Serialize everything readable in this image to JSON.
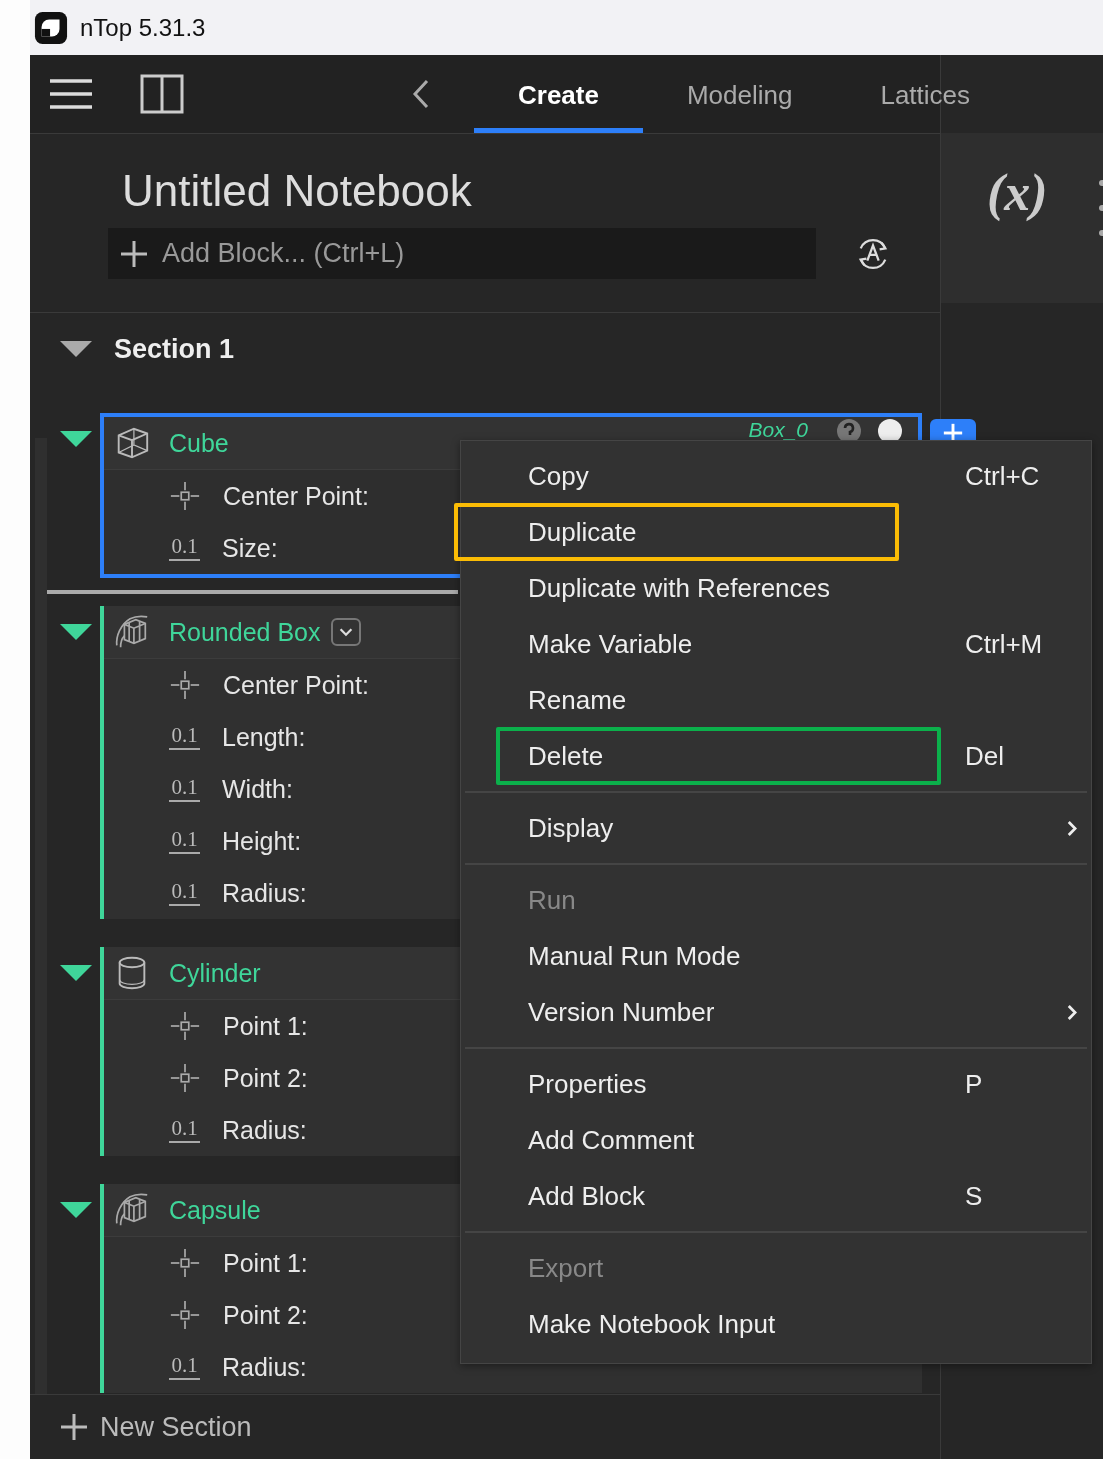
{
  "window": {
    "title": "nTop 5.31.3"
  },
  "tabs": [
    {
      "label": "Create",
      "selected": true
    },
    {
      "label": "Modeling",
      "selected": false
    },
    {
      "label": "Lattices",
      "selected": false
    }
  ],
  "notebook": {
    "title": "Untitled Notebook",
    "add_block": {
      "placeholder": "Add Block... (Ctrl+L)"
    }
  },
  "variables_panel": {
    "label": "(x)"
  },
  "section": {
    "title": "Section 1",
    "expanded": true
  },
  "blocks": [
    {
      "name": "Cube",
      "kind": "cube",
      "selected": true,
      "expanded": true,
      "dropdown": false,
      "output": "Box_0",
      "params": [
        {
          "kind": "point",
          "label": "Center Point:"
        },
        {
          "kind": "scalar",
          "badge": "0.1",
          "label": "Size:"
        }
      ]
    },
    {
      "name": "Rounded Box",
      "kind": "mesh",
      "selected": false,
      "expanded": true,
      "dropdown": true,
      "params": [
        {
          "kind": "point",
          "label": "Center Point:"
        },
        {
          "kind": "scalar",
          "badge": "0.1",
          "label": "Length:"
        },
        {
          "kind": "scalar",
          "badge": "0.1",
          "label": "Width:"
        },
        {
          "kind": "scalar",
          "badge": "0.1",
          "label": "Height:"
        },
        {
          "kind": "scalar",
          "badge": "0.1",
          "label": "Radius:"
        }
      ]
    },
    {
      "name": "Cylinder",
      "kind": "cylinder",
      "selected": false,
      "expanded": true,
      "dropdown": false,
      "params": [
        {
          "kind": "point",
          "label": "Point 1:"
        },
        {
          "kind": "point",
          "label": "Point 2:"
        },
        {
          "kind": "scalar",
          "badge": "0.1",
          "label": "Radius:"
        }
      ]
    },
    {
      "name": "Capsule",
      "kind": "mesh",
      "selected": false,
      "expanded": true,
      "dropdown": false,
      "params": [
        {
          "kind": "point",
          "label": "Point 1:"
        },
        {
          "kind": "point",
          "label": "Point 2:"
        },
        {
          "kind": "scalar",
          "badge": "0.1",
          "label": "Radius:"
        }
      ]
    }
  ],
  "new_section": {
    "label": "New Section"
  },
  "context_menu": {
    "groups": [
      [
        {
          "label": "Copy",
          "shortcut": "Ctrl+C",
          "disabled": false,
          "submenu": false
        },
        {
          "label": "Duplicate",
          "disabled": false,
          "submenu": false,
          "color": "#fbbc05"
        },
        {
          "label": "Duplicate with References",
          "disabled": false,
          "submenu": false
        },
        {
          "label": "Make Variable",
          "shortcut": "Ctrl+M",
          "disabled": false,
          "submenu": false
        },
        {
          "label": "Rename",
          "disabled": false,
          "submenu": false
        },
        {
          "label": "Delete",
          "shortcut": "Del",
          "disabled": false,
          "submenu": false,
          "color": "#0bb04b"
        }
      ],
      [
        {
          "label": "Display",
          "disabled": false,
          "submenu": true
        }
      ],
      [
        {
          "label": "Run",
          "disabled": true,
          "submenu": false
        },
        {
          "label": "Manual Run Mode",
          "disabled": false,
          "submenu": false
        },
        {
          "label": "Version Number",
          "disabled": false,
          "submenu": true
        }
      ],
      [
        {
          "label": "Properties",
          "shortcut": "P",
          "disabled": false,
          "submenu": false
        },
        {
          "label": "Add Comment",
          "disabled": false,
          "submenu": false
        },
        {
          "label": "Add Block",
          "shortcut": "S",
          "disabled": false,
          "submenu": false
        }
      ],
      [
        {
          "label": "Export",
          "disabled": true,
          "submenu": false
        },
        {
          "label": "Make Notebook Input",
          "disabled": false,
          "submenu": false
        }
      ]
    ]
  }
}
